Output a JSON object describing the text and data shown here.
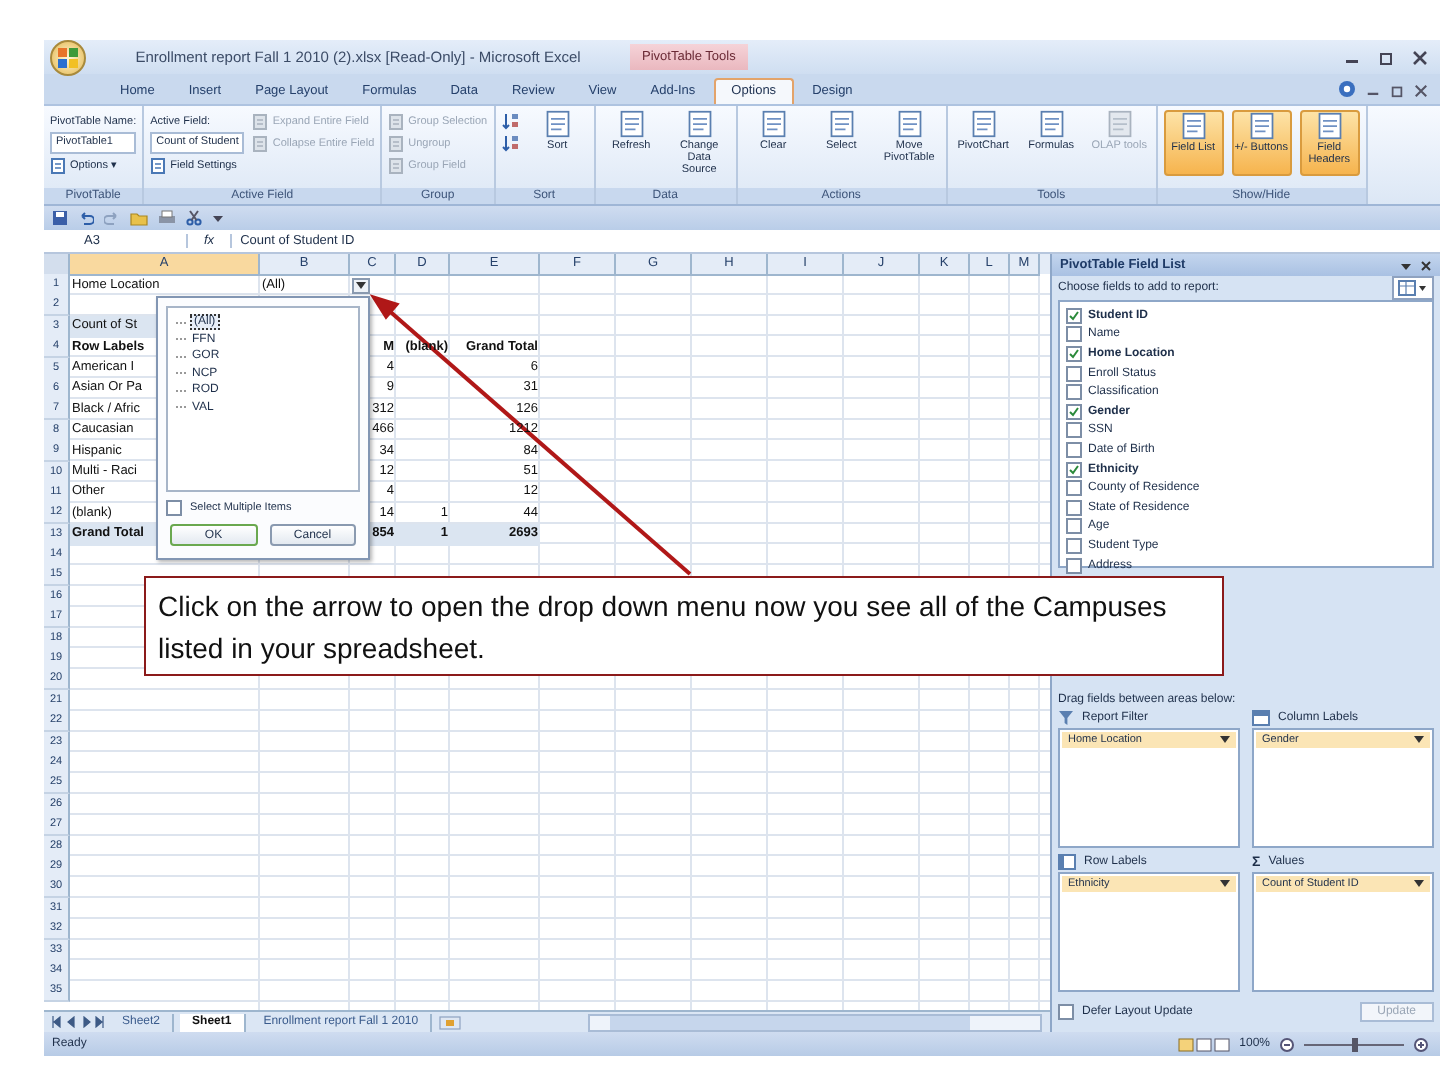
{
  "window": {
    "title": "Enrollment report Fall 1 2010 (2).xlsx  [Read-Only] - Microsoft Excel",
    "context_tab": "PivotTable Tools"
  },
  "ribbon_tabs": [
    {
      "label": "Home",
      "selected": false
    },
    {
      "label": "Insert",
      "selected": false
    },
    {
      "label": "Page Layout",
      "selected": false
    },
    {
      "label": "Formulas",
      "selected": false
    },
    {
      "label": "Data",
      "selected": false
    },
    {
      "label": "Review",
      "selected": false
    },
    {
      "label": "View",
      "selected": false
    },
    {
      "label": "Add-Ins",
      "selected": false
    },
    {
      "label": "Options",
      "selected": true
    },
    {
      "label": "Design",
      "selected": false
    }
  ],
  "ribbon_groups": [
    {
      "label": "PivotTable",
      "items": [
        {
          "kind": "text",
          "label": "PivotTable Name:"
        },
        {
          "kind": "box",
          "label": "PivotTable1"
        },
        {
          "kind": "small",
          "label": "Options ▾",
          "disabled": false
        }
      ]
    },
    {
      "label": "Active Field",
      "items": [
        {
          "kind": "text",
          "label": "Active Field:"
        },
        {
          "kind": "box",
          "label": "Count of Student"
        },
        {
          "kind": "small",
          "label": "Field Settings",
          "disabled": false
        },
        {
          "kind": "small",
          "label": "Expand Entire Field",
          "disabled": true
        },
        {
          "kind": "small",
          "label": "Collapse Entire Field",
          "disabled": true
        }
      ]
    },
    {
      "label": "Group",
      "items": [
        {
          "kind": "small",
          "label": "Group Selection",
          "disabled": true
        },
        {
          "kind": "small",
          "label": "Ungroup",
          "disabled": true
        },
        {
          "kind": "small",
          "label": "Group Field",
          "disabled": true
        }
      ]
    },
    {
      "label": "Sort",
      "items": [
        {
          "kind": "icon",
          "disabled": false
        },
        {
          "kind": "icon",
          "disabled": false
        },
        {
          "kind": "large",
          "label": "Sort",
          "disabled": false,
          "selected": false
        }
      ]
    },
    {
      "label": "Data",
      "items": [
        {
          "kind": "large",
          "label": "Refresh",
          "disabled": false,
          "selected": false
        },
        {
          "kind": "large",
          "label": "Change Data Source",
          "disabled": false,
          "selected": false
        }
      ]
    },
    {
      "label": "Actions",
      "items": [
        {
          "kind": "large",
          "label": "Clear",
          "disabled": false,
          "selected": false
        },
        {
          "kind": "large",
          "label": "Select",
          "disabled": false,
          "selected": false
        },
        {
          "kind": "large",
          "label": "Move PivotTable",
          "disabled": false,
          "selected": false
        }
      ]
    },
    {
      "label": "Tools",
      "items": [
        {
          "kind": "large",
          "label": "PivotChart",
          "disabled": false,
          "selected": false
        },
        {
          "kind": "large",
          "label": "Formulas",
          "disabled": false,
          "selected": false
        },
        {
          "kind": "large",
          "label": "OLAP tools",
          "disabled": true,
          "selected": false
        }
      ]
    },
    {
      "label": "Show/Hide",
      "items": [
        {
          "kind": "large",
          "label": "Field List",
          "disabled": false,
          "selected": true
        },
        {
          "kind": "large",
          "label": "+/- Buttons",
          "disabled": false,
          "selected": true
        },
        {
          "kind": "large",
          "label": "Field Headers",
          "disabled": false,
          "selected": true
        }
      ]
    }
  ],
  "formula_bar": {
    "name_box": "A3",
    "fx": "fx",
    "value": "Count of Student ID"
  },
  "columns": [
    "A",
    "B",
    "C",
    "D",
    "E",
    "F",
    "G",
    "H",
    "I",
    "J",
    "K",
    "L",
    "M"
  ],
  "rows": [
    {
      "number": "1",
      "kind": "filter",
      "cells": {
        "A": "Home Location",
        "B": "(All)"
      }
    },
    {
      "number": "2",
      "kind": "blank"
    },
    {
      "number": "3",
      "kind": "title",
      "cells": {
        "A": "Count of St"
      }
    },
    {
      "number": "4",
      "kind": "labels",
      "cells": {
        "A": "Row Labels",
        "C": "M",
        "D": "(blank)",
        "E": "Grand Total"
      }
    },
    {
      "number": "5",
      "kind": "data",
      "cells": {
        "A": "American I",
        "C": "4",
        "E": "6"
      }
    },
    {
      "number": "6",
      "kind": "data",
      "cells": {
        "A": "Asian Or Pa",
        "C": "9",
        "E": "31"
      }
    },
    {
      "number": "7",
      "kind": "data",
      "cells": {
        "A": "Black / Afric",
        "C": "312",
        "E": "126"
      }
    },
    {
      "number": "8",
      "kind": "data",
      "cells": {
        "A": "Caucasian",
        "C": "466",
        "E": "1212"
      }
    },
    {
      "number": "9",
      "kind": "data",
      "cells": {
        "A": "Hispanic",
        "C": "34",
        "E": "84"
      }
    },
    {
      "number": "10",
      "kind": "data",
      "cells": {
        "A": "Multi - Raci",
        "C": "12",
        "E": "51"
      }
    },
    {
      "number": "11",
      "kind": "data",
      "cells": {
        "A": "Other",
        "C": "4",
        "E": "12"
      }
    },
    {
      "number": "12",
      "kind": "data",
      "cells": {
        "A": "(blank)",
        "C": "14",
        "D": "1",
        "E": "44"
      }
    },
    {
      "number": "13",
      "kind": "total",
      "cells": {
        "A": "Grand Total",
        "C": "854",
        "D": "1",
        "E": "2693"
      }
    },
    {
      "number": "14",
      "kind": "blank"
    },
    {
      "number": "15",
      "kind": "blank"
    },
    {
      "number": "16",
      "kind": "blank"
    },
    {
      "number": "17",
      "kind": "blank"
    },
    {
      "number": "18",
      "kind": "blank"
    },
    {
      "number": "19",
      "kind": "blank"
    },
    {
      "number": "20",
      "kind": "blank"
    },
    {
      "number": "21",
      "kind": "blank"
    },
    {
      "number": "22",
      "kind": "blank"
    },
    {
      "number": "23",
      "kind": "blank"
    },
    {
      "number": "24",
      "kind": "blank"
    },
    {
      "number": "25",
      "kind": "blank"
    },
    {
      "number": "26",
      "kind": "blank"
    },
    {
      "number": "27",
      "kind": "blank"
    },
    {
      "number": "28",
      "kind": "blank"
    },
    {
      "number": "29",
      "kind": "blank"
    },
    {
      "number": "30",
      "kind": "blank"
    },
    {
      "number": "31",
      "kind": "blank"
    },
    {
      "number": "32",
      "kind": "blank"
    },
    {
      "number": "33",
      "kind": "blank"
    },
    {
      "number": "34",
      "kind": "blank"
    },
    {
      "number": "35",
      "kind": "blank"
    }
  ],
  "filter_popup": {
    "items": [
      {
        "label": "(All)",
        "selected": true
      },
      {
        "label": "FFN",
        "selected": false
      },
      {
        "label": "GOR",
        "selected": false
      },
      {
        "label": "NCP",
        "selected": false
      },
      {
        "label": "ROD",
        "selected": false
      },
      {
        "label": "VAL",
        "selected": false
      }
    ],
    "multi_select": {
      "label": "Select Multiple Items",
      "checked": false
    },
    "buttons": [
      "OK",
      "Cancel"
    ]
  },
  "field_list": {
    "title": "PivotTable Field List",
    "prompt": "Choose fields to add to report:",
    "fields": [
      {
        "label": "Student ID",
        "checked": true
      },
      {
        "label": "Name",
        "checked": false
      },
      {
        "label": "Home Location",
        "checked": true
      },
      {
        "label": "Enroll Status",
        "checked": false
      },
      {
        "label": "Classification",
        "checked": false
      },
      {
        "label": "Gender",
        "checked": true
      },
      {
        "label": "SSN",
        "checked": false
      },
      {
        "label": "Date of Birth",
        "checked": false
      },
      {
        "label": "Ethnicity",
        "checked": true
      },
      {
        "label": "County of Residence",
        "checked": false
      },
      {
        "label": "State of Residence",
        "checked": false
      },
      {
        "label": "Age",
        "checked": false
      },
      {
        "label": "Student Type",
        "checked": false
      },
      {
        "label": "Address",
        "checked": false
      }
    ],
    "areas_prompt": "Drag fields between areas below:",
    "areas": [
      {
        "kind": "filter",
        "title": "Report Filter",
        "field": "Home Location"
      },
      {
        "kind": "columns",
        "title": "Column Labels",
        "field": "Gender"
      },
      {
        "kind": "rows",
        "title": "Row Labels",
        "field": "Ethnicity"
      },
      {
        "kind": "values",
        "symbol": "Σ",
        "title": "Values",
        "field": "Count of Student ID"
      }
    ],
    "defer": {
      "label": "Defer Layout Update",
      "checked": false
    },
    "update": {
      "label": "Update",
      "disabled": true
    }
  },
  "sheet_tabs": [
    {
      "label": "Sheet2",
      "selected": false
    },
    {
      "label": "Sheet1",
      "selected": true
    },
    {
      "label": "Enrollment report Fall 1 2010",
      "selected": false
    }
  ],
  "status_bar": {
    "text": "Ready",
    "zoom": "100%",
    "zoom_slider": {
      "level": 0.5
    }
  },
  "callout": {
    "text": "Click on the arrow to open the drop down menu now you see all of the Campuses listed in your spreadsheet."
  }
}
